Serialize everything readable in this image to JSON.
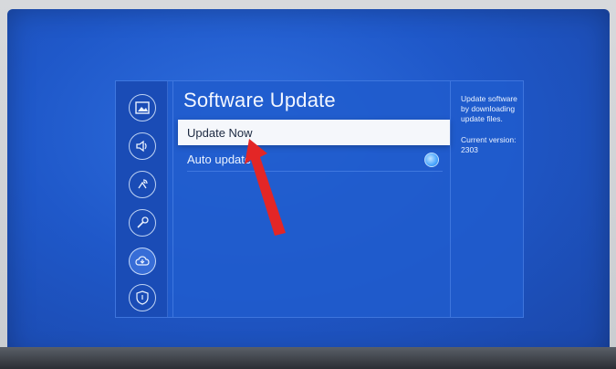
{
  "colors": {
    "screen_blue": "#1f58c9",
    "panel_blue": "#205ccd",
    "selection_white": "#f5f7fb",
    "arrow_red": "#e32626",
    "toggle_blue": "#4aa6ff"
  },
  "sidebar": {
    "items": [
      {
        "icon": "picture-icon"
      },
      {
        "icon": "sound-icon"
      },
      {
        "icon": "broadcast-icon"
      },
      {
        "icon": "wrench-icon"
      },
      {
        "icon": "cloud-update-icon",
        "active": true
      },
      {
        "icon": "shield-icon"
      }
    ]
  },
  "main": {
    "title": "Software Update",
    "items": [
      {
        "label": "Update Now",
        "selected": true
      },
      {
        "label": "Auto update",
        "toggle": true
      }
    ]
  },
  "info": {
    "description": "Update software by downloading update files.",
    "version": "Current version: 2303"
  }
}
